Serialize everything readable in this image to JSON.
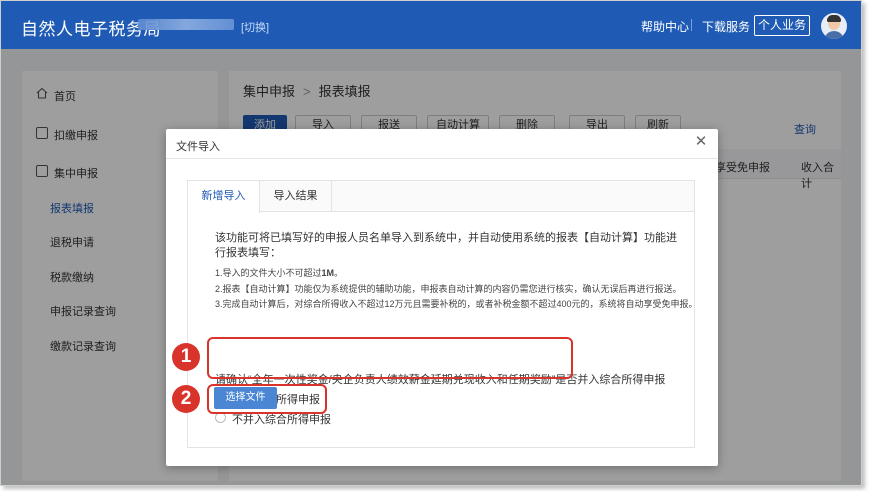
{
  "header": {
    "logo": "自然人电子税务局",
    "switch_label": "[切换]",
    "help": "帮助中心",
    "download": "下载服务",
    "personal": "个人业务",
    "brand_color": "#1f5bb5"
  },
  "sidebar": {
    "home": "首页",
    "withhold": "扣缴申报",
    "centralized": "集中申报",
    "subitems": [
      "报表填报",
      "退税申请",
      "税款缴纳",
      "申报记录查询",
      "缴款记录查询"
    ]
  },
  "content": {
    "breadcrumb": [
      "集中申报",
      "报表填报"
    ],
    "toolbar": [
      "添加",
      "导入",
      "报送",
      "自动计算",
      "删除",
      "导出",
      "刷新"
    ],
    "query": "查询",
    "table_headers": [
      "享受免申报",
      "收入合计"
    ]
  },
  "modal": {
    "title": "文件导入",
    "tabs": [
      "新增导入",
      "导入结果"
    ],
    "intro": "该功能可将已填写好的申报人员名单导入到系统中，并自动使用系统的报表【自动计算】功能进行报表填写：",
    "note1_prefix": "1.导入的文件大小不可超过",
    "note1_size": "1M",
    "note1_suffix": "。",
    "note2": "2.报表【自动计算】功能仅为系统提供的辅助功能，申报表自动计算的内容仍需您进行核实，确认无误后再进行报送。",
    "note3": "3.完成自动计算后，对综合所得收入不超过12万元且需要补税的，或者补税金额不超过400元的，系统将自动享受免申报。",
    "question": "请确认“全年一次性奖金/央企负责人绩效薪金延期兑现收入和任期奖励”是否并入综合所得申报",
    "options": [
      "并入综合所得申报",
      "不并入综合所得申报"
    ],
    "selected": 0,
    "choose_file": "选择文件"
  },
  "annotations": [
    "1",
    "2"
  ],
  "annotation_color": "#d9342b"
}
